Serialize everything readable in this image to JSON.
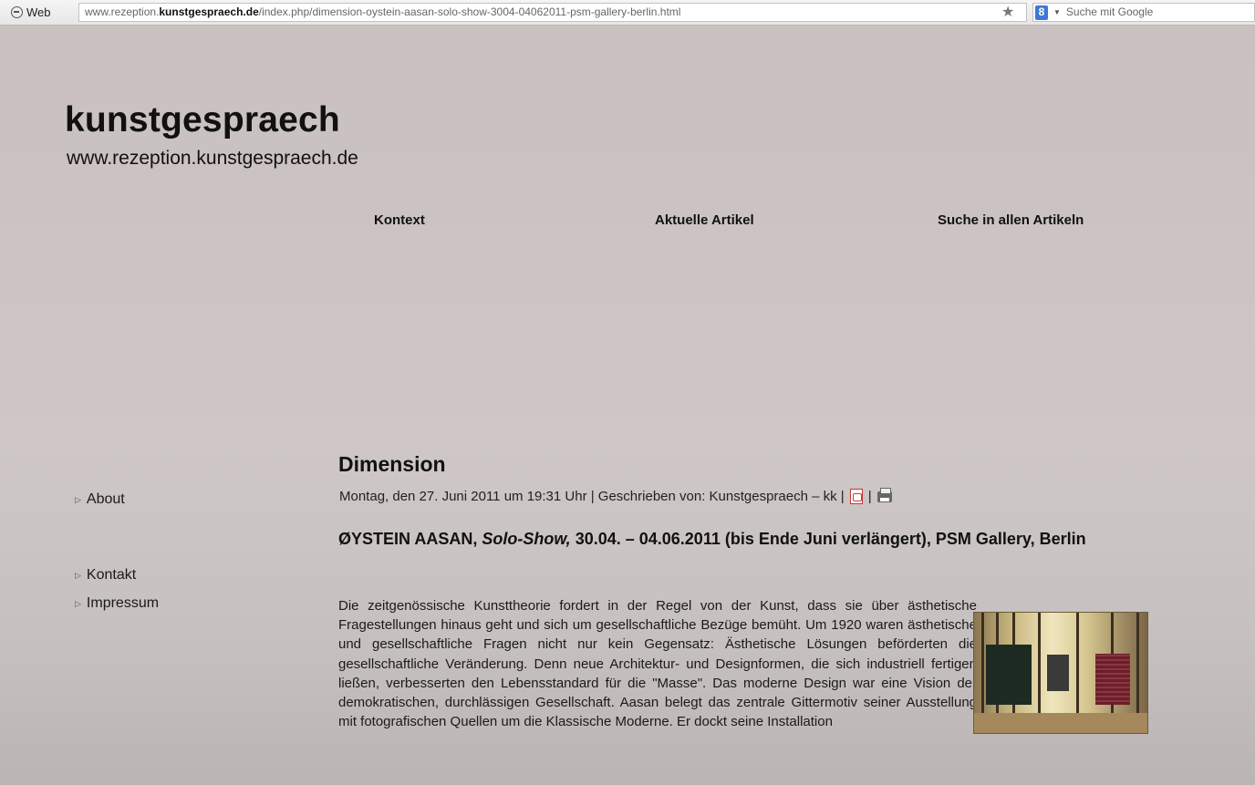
{
  "browser": {
    "web_label": "Web",
    "url_prefix": "www.rezeption.",
    "url_domain": "kunstgespraech.de",
    "url_path": "/index.php/dimension-oystein-aasan-solo-show-3004-04062011-psm-gallery-berlin.html",
    "search_placeholder": "Suche mit Google"
  },
  "site": {
    "title": "kunstgespraech",
    "subtitle": "www.rezeption.kunstgespraech.de"
  },
  "topnav": {
    "kontext": "Kontext",
    "aktuelle_artikel": "Aktuelle Artikel",
    "suche": "Suche in allen Artikeln"
  },
  "sidebar": {
    "items": [
      {
        "label": "About"
      },
      {
        "label": "Kontakt"
      },
      {
        "label": "Impressum"
      }
    ]
  },
  "article": {
    "title": "Dimension",
    "meta": "Montag, den 27. Juni 2011 um 19:31 Uhr | Geschrieben von: Kunstgespraech – kk |",
    "meta_sep": "|",
    "subhead_pre": "ØYSTEIN AASAN, ",
    "subhead_italic": "Solo-Show,",
    "subhead_post": " 30.04. – 04.06.2011 (bis Ende Juni verlängert), PSM Gallery, Berlin",
    "body": "Die zeitgenössische Kunsttheorie fordert in der Regel von der Kunst, dass sie über ästhetische Fragestellungen hinaus geht und sich um gesellschaftliche Bezüge bemüht. Um 1920 waren ästhetische und gesellschaftliche Fragen nicht nur kein Gegensatz: Ästhetische Lösungen beförderten die gesellschaftliche Veränderung. Denn neue Architektur- und Designformen, die sich industriell fertigen ließen, verbesserten den Lebensstandard für die \"Masse\". Das moderne Design war eine Vision der demokratischen, durchlässigen Gesellschaft. Aasan belegt das zentrale Gittermotiv seiner Ausstellung mit fotografischen Quellen um die Klassische Moderne. Er dockt seine Installation"
  }
}
